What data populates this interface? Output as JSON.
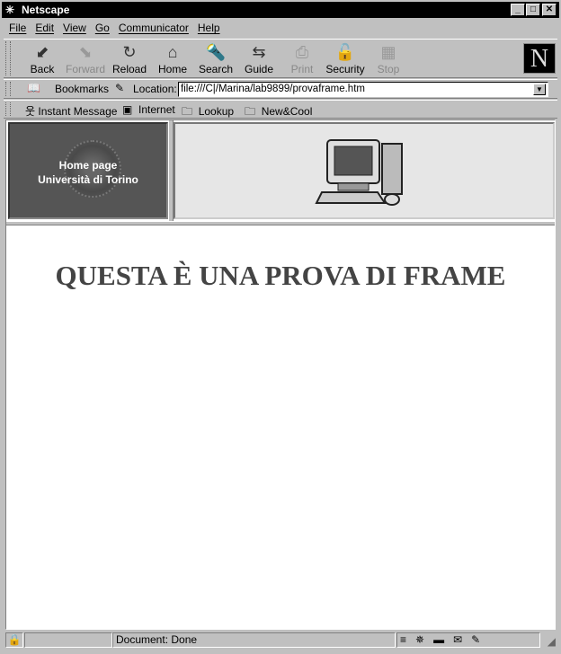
{
  "window": {
    "title": "Netscape"
  },
  "menu": [
    "File",
    "Edit",
    "View",
    "Go",
    "Communicator",
    "Help"
  ],
  "toolbar": [
    {
      "label": "Back",
      "icon": "back-arrow-icon",
      "enabled": true
    },
    {
      "label": "Forward",
      "icon": "forward-arrow-icon",
      "enabled": false
    },
    {
      "label": "Reload",
      "icon": "reload-icon",
      "enabled": true
    },
    {
      "label": "Home",
      "icon": "home-icon",
      "enabled": true
    },
    {
      "label": "Search",
      "icon": "search-flashlight-icon",
      "enabled": true
    },
    {
      "label": "Guide",
      "icon": "guide-signpost-icon",
      "enabled": true
    },
    {
      "label": "Print",
      "icon": "printer-icon",
      "enabled": false
    },
    {
      "label": "Security",
      "icon": "padlock-icon",
      "enabled": true
    },
    {
      "label": "Stop",
      "icon": "stop-icon",
      "enabled": false
    }
  ],
  "location": {
    "bookmarks_label": "Bookmarks",
    "location_label": "Location:",
    "url": "file:///C|/Marina/lab9899/provaframe.htm"
  },
  "personal": [
    "Instant Message",
    "Internet",
    "Lookup",
    "New&Cool"
  ],
  "frame_left": {
    "line1": "Home page",
    "line2": "Università di Torino"
  },
  "frame_main": {
    "heading": "QUESTA È UNA PROVA DI FRAME"
  },
  "status": {
    "text": "Document: Done"
  }
}
